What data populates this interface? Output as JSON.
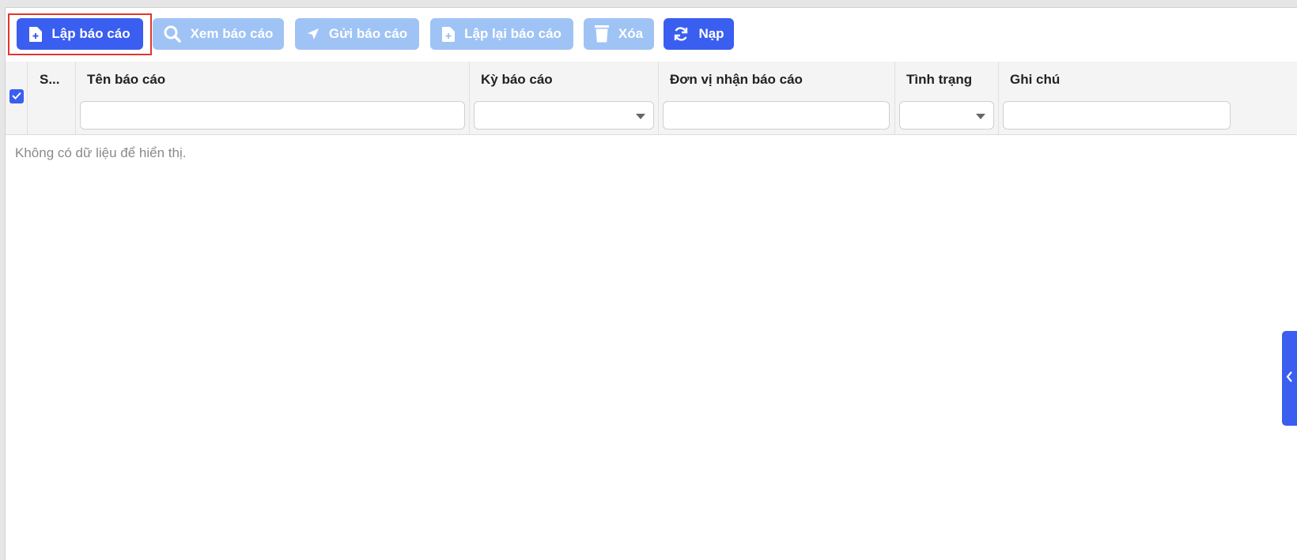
{
  "toolbar": {
    "create_report": "Lập báo cáo",
    "view_report": "Xem báo cáo",
    "send_report": "Gửi báo cáo",
    "recreate_report": "Lập lại báo cáo",
    "delete": "Xóa",
    "reload": "Nạp"
  },
  "table": {
    "columns": [
      "S...",
      "Tên báo cáo",
      "Kỳ báo cáo",
      "Đơn vị nhận báo cáo",
      "Tình trạng",
      "Ghi chú"
    ],
    "empty_message": "Không có dữ liệu để hiển thị."
  },
  "colors": {
    "accent": "#3a5ef0",
    "disabled": "#9fc3f5",
    "highlight": "#e0362c"
  },
  "icons": [
    "add-document-icon",
    "search-icon",
    "send-icon",
    "copy-document-icon",
    "trash-icon",
    "refresh-icon",
    "check-icon",
    "chevron-left-icon"
  ]
}
